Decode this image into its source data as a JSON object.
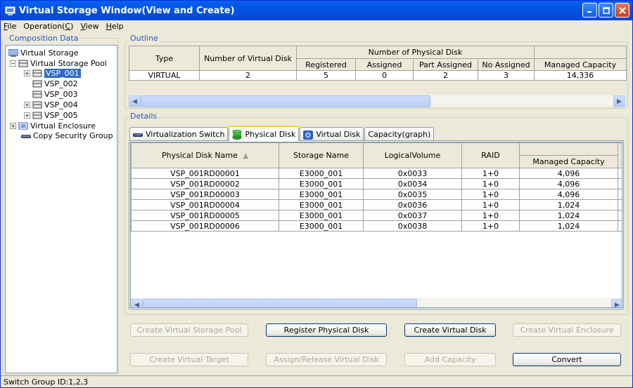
{
  "window": {
    "title": "Virtual Storage Window(View and Create)"
  },
  "menu": [
    "File",
    "Operation(C)",
    "View",
    "Help"
  ],
  "menu_underline": [
    "F",
    "C",
    "V",
    "H"
  ],
  "composition": {
    "title": "Composition Data"
  },
  "tree": {
    "root": "Virtual Storage",
    "pool": "Virtual Storage Pool",
    "items": [
      "VSP_001",
      "VSP_002",
      "VSP_003",
      "VSP_004",
      "VSP_005"
    ],
    "enclosure": "Virtual Enclosure",
    "copy": "Copy Security Group"
  },
  "outline": {
    "title": "Outline",
    "headers": {
      "type": "Type",
      "num_vdisk": "Number of Virtual Disk",
      "num_pdisk": "Number of Physical Disk",
      "registered": "Registered",
      "assigned": "Assigned",
      "part_assigned": "Part Assigned",
      "no_assigned": "No Assigned",
      "managed": "Managed Capacity"
    },
    "row": {
      "type": "VIRTUAL",
      "num_vdisk": "2",
      "registered": "5",
      "assigned": "0",
      "part_assigned": "2",
      "no_assigned": "3",
      "managed": "14,336"
    }
  },
  "details": {
    "title": "Details",
    "tabs": [
      "Virtualization Switch",
      "Physical Disk",
      "Virtual Disk",
      "Capacity(graph)"
    ],
    "columns": {
      "name": "Physical Disk Name",
      "storage": "Storage Name",
      "lv": "LogicalVolume",
      "raid": "RAID",
      "managed": "Managed Capacity"
    },
    "sort_indicator": "▲",
    "rows": [
      {
        "name": "VSP_001RD00001",
        "storage": "E3000_001",
        "lv": "0x0033",
        "raid": "1+0",
        "managed": "4,096"
      },
      {
        "name": "VSP_001RD00002",
        "storage": "E3000_001",
        "lv": "0x0034",
        "raid": "1+0",
        "managed": "4,096"
      },
      {
        "name": "VSP_001RD00003",
        "storage": "E3000_001",
        "lv": "0x0035",
        "raid": "1+0",
        "managed": "4,096"
      },
      {
        "name": "VSP_001RD00004",
        "storage": "E3000_001",
        "lv": "0x0036",
        "raid": "1+0",
        "managed": "1,024"
      },
      {
        "name": "VSP_001RD00005",
        "storage": "E3000_001",
        "lv": "0x0037",
        "raid": "1+0",
        "managed": "1,024"
      },
      {
        "name": "VSP_001RD00006",
        "storage": "E3000_001",
        "lv": "0x0038",
        "raid": "1+0",
        "managed": "1,024"
      }
    ]
  },
  "buttons": {
    "create_pool": "Create Virtual Storage Pool",
    "register_pdisk": "Register Physical Disk",
    "create_vdisk": "Create Virtual Disk",
    "create_enclosure": "Create Virtual Enclosure",
    "create_target": "Create Virtual Target",
    "assign_release": "Assign/Release Virtual Disk",
    "add_capacity": "Add Capacity",
    "convert": "Convert"
  },
  "status": {
    "text": "Switch Group ID:1,2,3"
  },
  "colors": {
    "accent": "#316AC5",
    "group_title": "#2057C8",
    "titlebar": "#0053E1"
  }
}
